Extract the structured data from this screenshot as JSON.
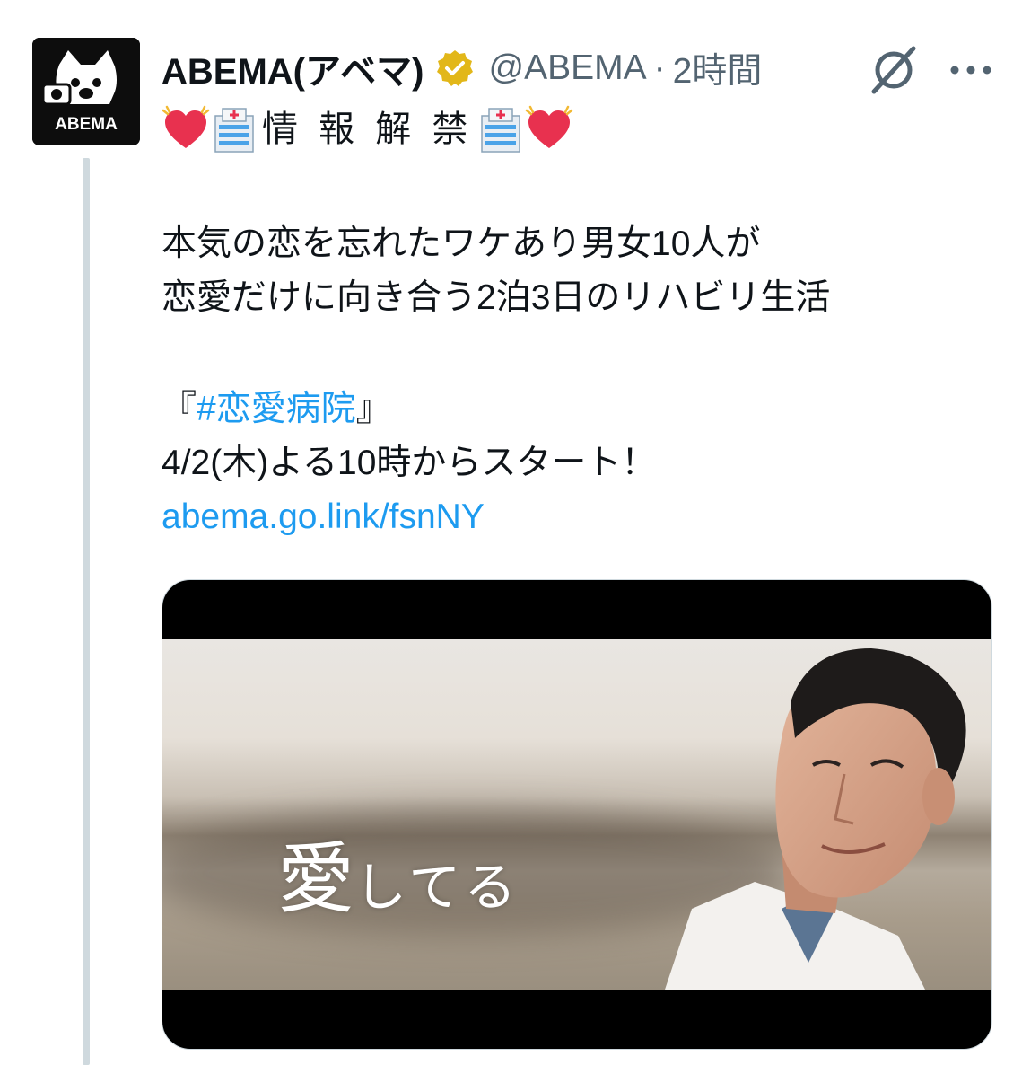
{
  "tweet": {
    "display_name": "ABEMA(アベマ)",
    "handle": "@ABEMA",
    "separator": "·",
    "time": "2時間",
    "avatar_label": "ABEMA",
    "header_line": {
      "kanji": "情 報 解 禁"
    },
    "body_lines": [
      "本気の恋を忘れたワケあり男女10人が",
      "恋愛だけに向き合う2泊3日のリハビリ生活"
    ],
    "quote_open": "『",
    "hashtag": "#恋愛病院",
    "quote_close": "』",
    "schedule": "4/2(木)よる10時からスタート！",
    "link": "abema.go.link/fsnNY",
    "media": {
      "overlay_big": "愛",
      "overlay_small": "してる"
    }
  },
  "icons": {
    "verified": "verified-badge-icon",
    "grok": "grok-icon",
    "more": "more-dots-icon",
    "heart": "beating-heart-icon",
    "hospital": "hospital-icon"
  },
  "colors": {
    "link": "#1d9bf0",
    "secondary_text": "#536471",
    "verified_gold": "#e2b719",
    "heart_red": "#e8314f"
  }
}
